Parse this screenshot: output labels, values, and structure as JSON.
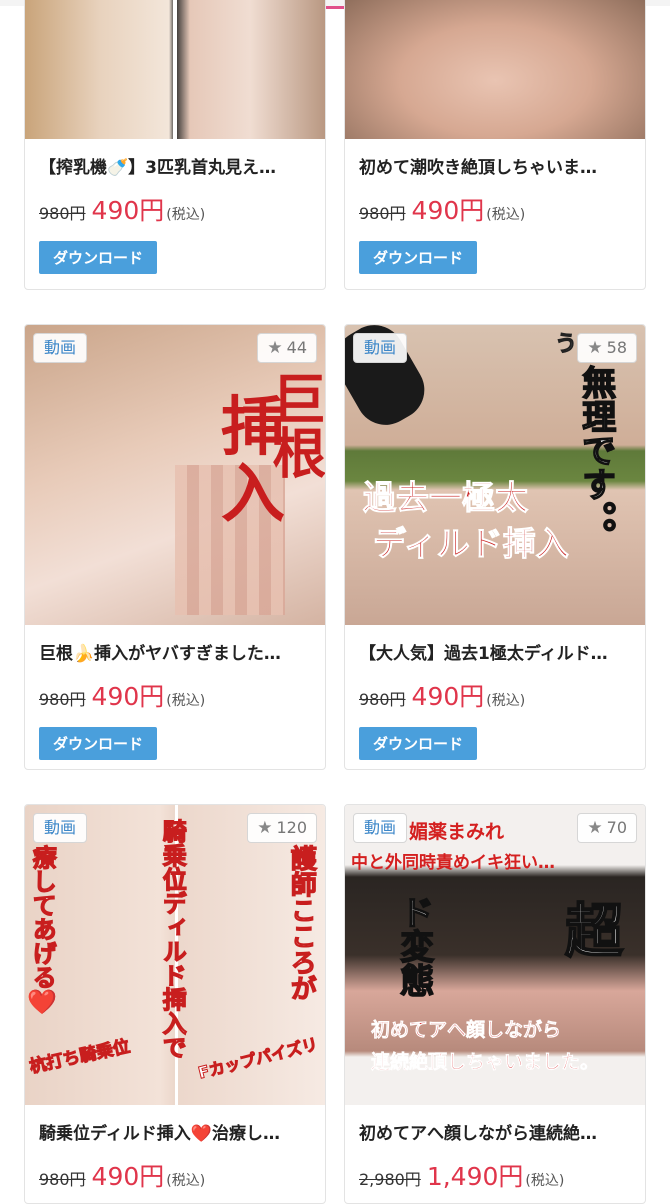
{
  "products": [
    {
      "title": "【搾乳機🍼】3匹乳首丸見え…",
      "old_price": "980円",
      "new_price": "490円",
      "tax": "(税込)",
      "download": "ダウンロード"
    },
    {
      "title": "初めて潮吹き絶頂しちゃいま…",
      "old_price": "980円",
      "new_price": "490円",
      "tax": "(税込)",
      "download": "ダウンロード"
    },
    {
      "badge": "動画",
      "favorites": "44",
      "overlay": [
        "巨根",
        "挿入"
      ],
      "title": "巨根🍌挿入がヤバすぎました…",
      "old_price": "980円",
      "new_price": "490円",
      "tax": "(税込)",
      "download": "ダウンロード"
    },
    {
      "badge": "動画",
      "favorites": "58",
      "overlay": [
        "う",
        "無理です。。",
        "過去一極太",
        "ディルド挿入"
      ],
      "title": "【大人気】過去1極太ディルド…",
      "old_price": "980円",
      "new_price": "490円",
      "tax": "(税込)",
      "download": "ダウンロード"
    },
    {
      "badge": "動画",
      "favorites": "120",
      "overlay": [
        "騎乗位ディルド挿入で",
        "護師こころが",
        "療してあげる❤️",
        "杭打ち騎乗位",
        "Fカップパイズリ"
      ],
      "title": "騎乗位ディルド挿入❤️治療し…",
      "old_price": "980円",
      "new_price": "490円",
      "tax": "(税込)"
    },
    {
      "badge": "動画",
      "favorites": "70",
      "overlay": [
        "媚薬まみれ",
        "中と外同時責めイキ狂い…",
        "ド変態",
        "超",
        "初めてアへ顔しながら",
        "連続絶頂しちゃいました。"
      ],
      "title": "初めてアへ顔しながら連続絶…",
      "old_price": "2,980円",
      "new_price": "1,490円",
      "tax": "(税込)"
    }
  ],
  "colors": {
    "accent": "#e0354b",
    "download_button": "#4a9fdc",
    "badge_text": "#3b86c8"
  },
  "icons": {
    "favorite": "star-icon"
  }
}
